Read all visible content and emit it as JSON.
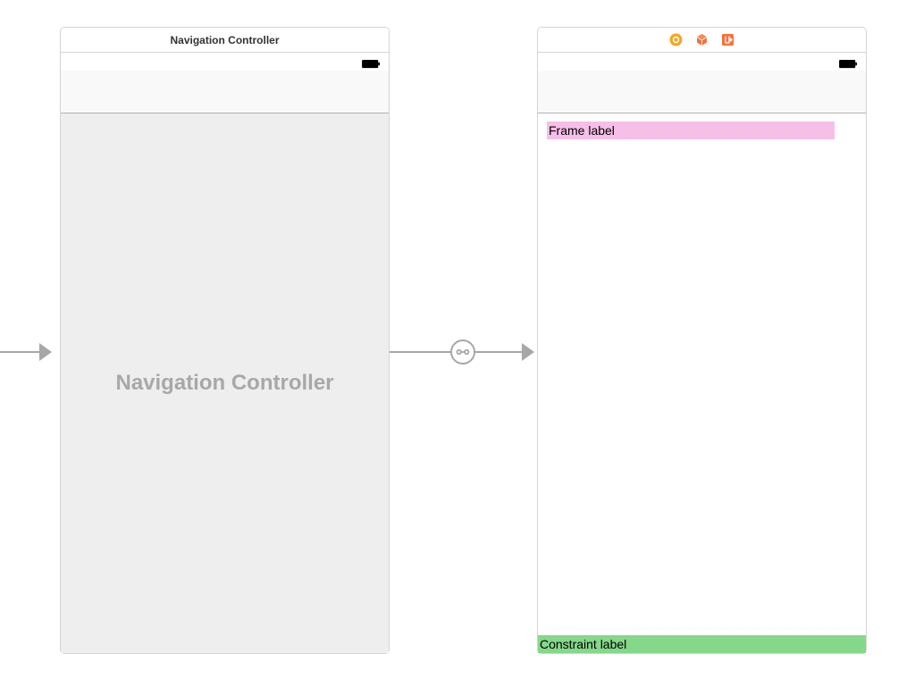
{
  "navController": {
    "headerTitle": "Navigation Controller",
    "placeholder": "Navigation Controller"
  },
  "viewController": {
    "frameLabel": "Frame label",
    "constraintLabel": "Constraint label"
  },
  "icons": {
    "classIcon": "class-circle-icon",
    "objectIcon": "cube-icon",
    "exitIcon": "exit-icon",
    "segueIcon": "relationship-segue-icon"
  },
  "colors": {
    "frameLabelBg": "#f6bfe8",
    "constraintLabelBg": "#85d88a",
    "iconOrange": "#f58220"
  }
}
